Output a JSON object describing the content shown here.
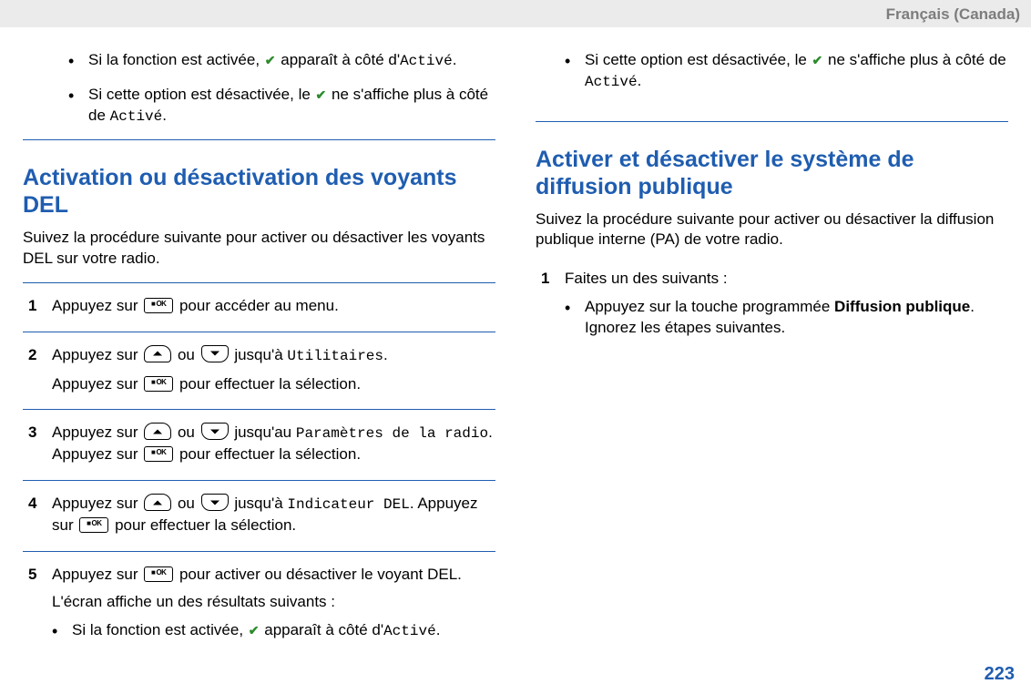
{
  "header": {
    "lang": "Français (Canada)"
  },
  "common": {
    "press": "Appuyez sur ",
    "or": " ou ",
    "to_menu": " pour accéder au menu.",
    "to": " jusqu'à ",
    "to_au": " jusqu'au ",
    "select_word": " pour effectuer la sélection.",
    "dot_press": ". Appuyez sur "
  },
  "labels": {
    "enabled": "Activé",
    "utilities": "Utilitaires",
    "radio_settings": "Paramètres de la radio",
    "led_indicator": "Indicateur DEL"
  },
  "top_bullets": {
    "b1_pre": "Si la fonction est activée, ",
    "b1_post": " apparaît à côté d'",
    "b2_pre": "Si cette option est désactivée, le ",
    "b2_post": " ne s'affiche plus à côté de "
  },
  "section_led": {
    "title": "Activation ou désactivation des voyants DEL",
    "intro": "Suivez la procédure suivante pour activer ou désactiver les voyants DEL sur votre radio.",
    "step5_a": " pour activer ou désactiver le voyant DEL.",
    "step5_b": "L'écran affiche un des résultats suivants :"
  },
  "section_pa": {
    "title": "Activer et désactiver le système de diffusion publique",
    "intro": "Suivez la procédure suivante pour activer ou désactiver la diffusion publique interne (PA) de votre radio.",
    "step1_intro": "Faites un des suivants :",
    "step1_b1_pre": "Appuyez sur la touche programmée ",
    "step1_b1_bold": "Diffusion publique",
    "step1_b1_post": ". Ignorez les étapes suivantes."
  },
  "page_number": "223"
}
